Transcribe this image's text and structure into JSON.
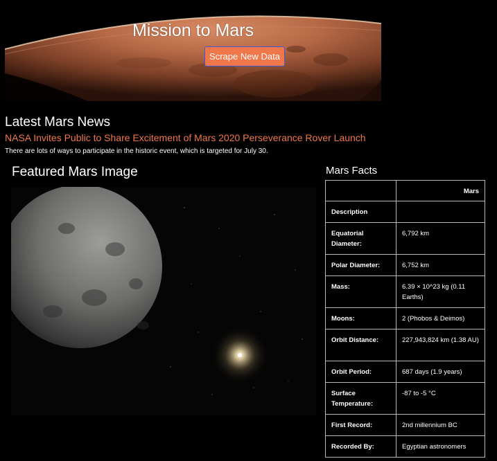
{
  "hero": {
    "title": "Mission to Mars",
    "button_label": "Scrape New Data"
  },
  "news": {
    "heading": "Latest Mars News",
    "title": "NASA Invites Public to Share Excitement of Mars 2020 Perseverance Rover Launch",
    "teaser": "There are lots of ways to participate in the historic event, which is targeted for July 30."
  },
  "featured": {
    "heading": "Featured Mars Image"
  },
  "facts": {
    "heading": "Mars Facts",
    "header_key": "",
    "header_value": "Mars",
    "rows": [
      {
        "key": "Description",
        "value": ""
      },
      {
        "key": "Equatorial Diameter:",
        "value": "6,792 km"
      },
      {
        "key": "Polar Diameter:",
        "value": "6,752 km"
      },
      {
        "key": "Mass:",
        "value": "6.39 × 10^23 kg (0.11 Earths)"
      },
      {
        "key": "Moons:",
        "value": "2 (Phobos & Deimos)"
      },
      {
        "key": "Orbit Distance:",
        "value": "227,943,824 km (1.38 AU)"
      },
      {
        "key": "Orbit Period:",
        "value": "687 days (1.9 years)"
      },
      {
        "key": "Surface Temperature:",
        "value": "-87 to -5 °C"
      },
      {
        "key": "First Record:",
        "value": "2nd millennium BC"
      },
      {
        "key": "Recorded By:",
        "value": "Egyptian astronomers"
      }
    ]
  },
  "colors": {
    "accent": "#f0774a",
    "background": "#000000",
    "button_border": "#3b5bdb"
  }
}
